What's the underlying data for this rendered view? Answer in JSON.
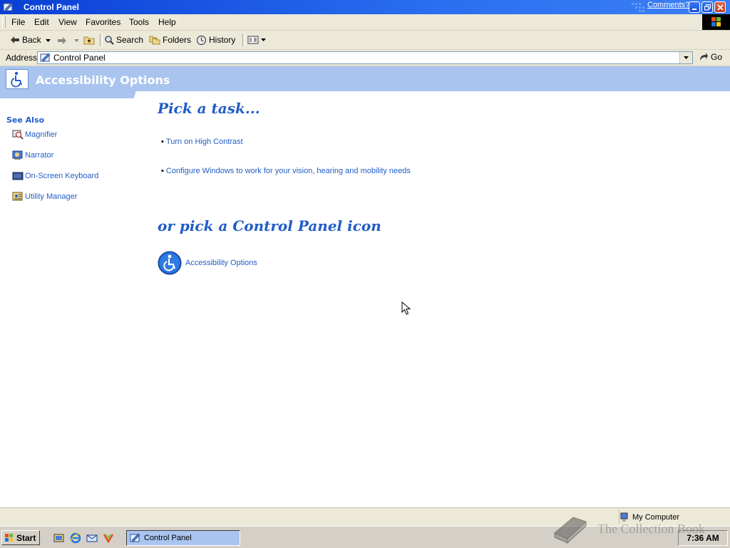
{
  "window": {
    "title": "Control Panel",
    "comments_link": "Comments?"
  },
  "menubar": {
    "items": [
      "File",
      "Edit",
      "View",
      "Favorites",
      "Tools",
      "Help"
    ]
  },
  "toolbar": {
    "back_label": "Back",
    "search_label": "Search",
    "folders_label": "Folders",
    "history_label": "History"
  },
  "address": {
    "label": "Address",
    "value": "Control Panel",
    "go_label": "Go"
  },
  "banner": {
    "title": "Accessibility Options"
  },
  "sidebar": {
    "heading": "See Also",
    "items": [
      {
        "label": "Magnifier",
        "icon": "magnifier-icon"
      },
      {
        "label": "Narrator",
        "icon": "narrator-icon"
      },
      {
        "label": "On-Screen Keyboard",
        "icon": "keyboard-icon"
      },
      {
        "label": "Utility Manager",
        "icon": "utility-manager-icon"
      }
    ]
  },
  "main": {
    "task_heading": "Pick a task...",
    "tasks": [
      "Turn on High Contrast",
      "Configure Windows to work for your vision, hearing and mobility needs"
    ],
    "icon_heading": "or pick a Control Panel icon",
    "icons": [
      {
        "label": "Accessibility Options",
        "icon": "accessibility-icon"
      }
    ]
  },
  "statusbar": {
    "zone": "My Computer"
  },
  "taskbar": {
    "start_label": "Start",
    "active_task": "Control Panel",
    "clock": "7:36 AM"
  },
  "watermark": {
    "text": "The Collection Book"
  },
  "colors": {
    "link": "#215dc6",
    "banner": "#a9c4ef",
    "titlebar": "#0a3fd6"
  }
}
